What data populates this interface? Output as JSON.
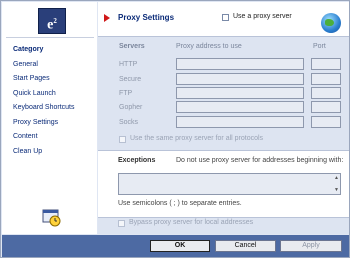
{
  "logo": {
    "text": "e",
    "sup": "2"
  },
  "sidebar": {
    "items": [
      {
        "label": "Category"
      },
      {
        "label": "General"
      },
      {
        "label": "Start Pages"
      },
      {
        "label": "Quick Launch"
      },
      {
        "label": "Keyboard Shortcuts"
      },
      {
        "label": "Proxy Settings"
      },
      {
        "label": "Content"
      },
      {
        "label": "Clean Up"
      }
    ]
  },
  "header": {
    "title": "Proxy Settings",
    "use_proxy_label": "Use a proxy server",
    "use_proxy_checked": false
  },
  "servers": {
    "heading": "Servers",
    "address_heading": "Proxy address to use",
    "port_heading": "Port",
    "rows": [
      {
        "label": "HTTP",
        "address": "",
        "port": ""
      },
      {
        "label": "Secure",
        "address": "",
        "port": ""
      },
      {
        "label": "FTP",
        "address": "",
        "port": ""
      },
      {
        "label": "Gopher",
        "address": "",
        "port": ""
      },
      {
        "label": "Socks",
        "address": "",
        "port": ""
      }
    ],
    "same_proxy_label": "Use the same proxy server for all protocols"
  },
  "exceptions": {
    "title": "Exceptions",
    "description": "Do not use proxy server for addresses beginning with:",
    "value": "",
    "hint": "Use semicolons ( ; ) to separate entries."
  },
  "bypass": {
    "label": "Bypass proxy server for local addresses"
  },
  "footer": {
    "ok": "OK",
    "cancel": "Cancel",
    "apply": "Apply"
  },
  "colors": {
    "accent": "#0b2b78",
    "footer": "#4d6aa3",
    "arrow": "#d01818"
  },
  "icons": [
    "e2-logo",
    "clock-icon",
    "arrow-icon",
    "globe-icon"
  ]
}
